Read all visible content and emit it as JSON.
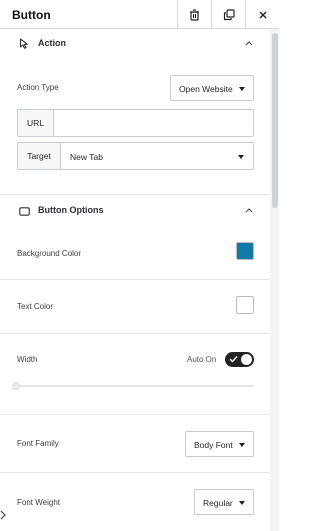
{
  "header": {
    "title": "Button",
    "actions": [
      {
        "name": "delete",
        "icon": "trash-icon"
      },
      {
        "name": "duplicate",
        "icon": "copy-icon"
      },
      {
        "name": "close",
        "icon": "close-icon"
      }
    ]
  },
  "action_section": {
    "title": "Action",
    "icon": "cursor-icon",
    "expanded": true,
    "action_type": {
      "label": "Action Type",
      "value": "Open Website"
    },
    "url": {
      "addon": "URL",
      "value": ""
    },
    "target": {
      "addon": "Target",
      "value": "New Tab"
    }
  },
  "options_section": {
    "title": "Button Options",
    "icon": "button-outline-icon",
    "expanded": true,
    "background_color": {
      "label": "Background Color",
      "value": "#1479a6"
    },
    "text_color": {
      "label": "Text Color",
      "value": "#ffffff"
    },
    "width": {
      "label": "Width",
      "auto_label": "Auto On",
      "auto_on": true,
      "slider_value": 0
    },
    "font_family": {
      "label": "Font Family",
      "value": "Body Font"
    },
    "font_weight": {
      "label": "Font Weight",
      "value": "Regular"
    }
  },
  "colors": {
    "border": "#d7d9dc",
    "toggle_on": "#222222",
    "accent_swatch": "#1479a6"
  }
}
